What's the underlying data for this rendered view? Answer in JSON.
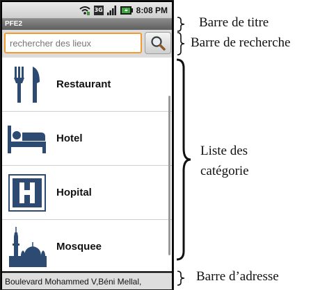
{
  "status_bar": {
    "network": "3G",
    "time": "8:08 PM"
  },
  "app": {
    "title": "PFE2"
  },
  "search": {
    "placeholder": "rechercher des lieux"
  },
  "categories": [
    {
      "label": "Restaurant",
      "icon": "fork-knife-icon"
    },
    {
      "label": "Hotel",
      "icon": "bed-icon"
    },
    {
      "label": "Hopital",
      "icon": "hospital-icon"
    },
    {
      "label": "Mosquee",
      "icon": "mosque-icon"
    }
  ],
  "address_bar": {
    "text": "Boulevard Mohammed V,Béni Mellal,"
  },
  "annotations": {
    "title_bar": "Barre de titre",
    "search_bar": "Barre de recherche",
    "list_line1": "Liste des",
    "list_line2": "catégorie",
    "address_bar": "Barre d’adresse"
  },
  "colors": {
    "icon_blue": "#2c4a72",
    "search_border": "#f29a2e"
  }
}
